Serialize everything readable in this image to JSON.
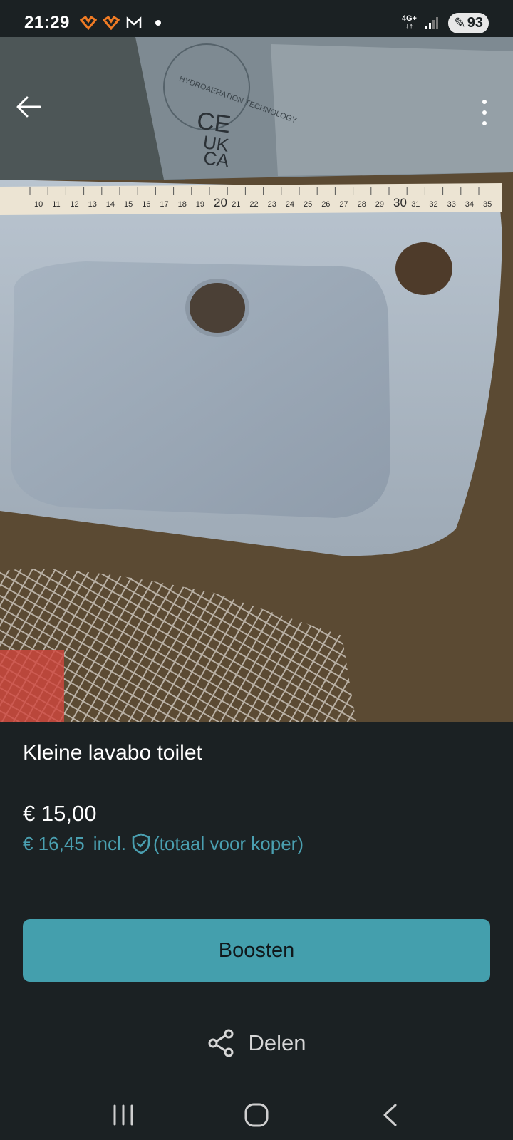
{
  "status_bar": {
    "time": "21:29",
    "network": "4G+",
    "battery": "93",
    "notification_icons": [
      "app-notification-icon",
      "app-notification-icon",
      "gmail-icon"
    ]
  },
  "listing": {
    "title": "Kleine lavabo toilet",
    "price": "€ 15,00",
    "total_price": "€ 16,45",
    "incl_label": "incl.",
    "total_note": "(totaal voor koper)"
  },
  "photo": {
    "image_count": 3,
    "current_index": 1,
    "ruler_numbers": [
      "10",
      "11",
      "12",
      "13",
      "14",
      "15",
      "16",
      "17",
      "18",
      "19",
      "20",
      "21",
      "22",
      "23",
      "24",
      "25",
      "26",
      "27",
      "28",
      "29",
      "30",
      "31",
      "32",
      "33",
      "34",
      "35"
    ],
    "box_text": [
      "HYDROAERATION TECHNOLOGY",
      "CE",
      "UK",
      "CA"
    ]
  },
  "actions": {
    "boost_label": "Boosten",
    "share_label": "Delen"
  },
  "colors": {
    "background": "#1b2123",
    "accent": "#449fad",
    "price_accent": "#4a9fb0"
  }
}
